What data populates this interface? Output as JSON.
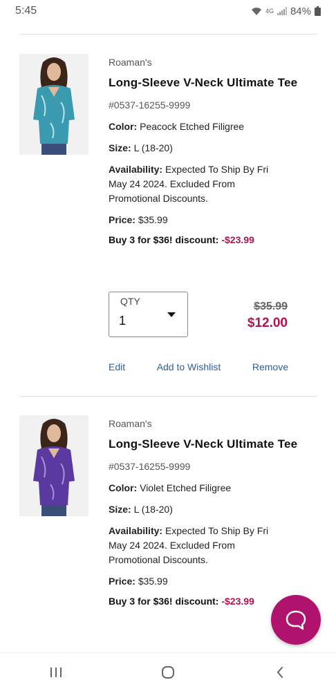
{
  "status": {
    "time": "5:45",
    "network": "4G",
    "battery": "84%"
  },
  "items": [
    {
      "brand": "Roaman's",
      "name": "Long-Sleeve V-Neck Ultimate Tee",
      "sku": "#0537-16255-9999",
      "color_label": "Color:",
      "color": "Peacock Etched Filigree",
      "size_label": "Size:",
      "size": "L (18-20)",
      "availability_label": "Availability:",
      "availability": "Expected To Ship By Fri May 24 2024. Excluded From Promotional Discounts.",
      "price_label": "Price:",
      "price": "$35.99",
      "discount_label": "Buy 3 for $36! discount:",
      "discount": "-$23.99",
      "qty_label": "QTY",
      "qty": "1",
      "old_price": "$35.99",
      "new_price": "$12.00",
      "shirt_color": "#3a9bb0"
    },
    {
      "brand": "Roaman's",
      "name": "Long-Sleeve V-Neck Ultimate Tee",
      "sku": "#0537-16255-9999",
      "color_label": "Color:",
      "color": "Violet Etched Filigree",
      "size_label": "Size:",
      "size": "L (18-20)",
      "availability_label": "Availability:",
      "availability": "Expected To Ship By Fri May 24 2024. Excluded From Promotional Discounts.",
      "price_label": "Price:",
      "price": "$35.99",
      "discount_label": "Buy 3 for $36! discount:",
      "discount": "-$23.99",
      "shirt_color": "#5a3aa0"
    }
  ],
  "actions": {
    "edit": "Edit",
    "wishlist": "Add to Wishlist",
    "remove": "Remove"
  },
  "colors": {
    "accent": "#b0134f",
    "link": "#2a5fa3",
    "fab": "#b0136e"
  }
}
